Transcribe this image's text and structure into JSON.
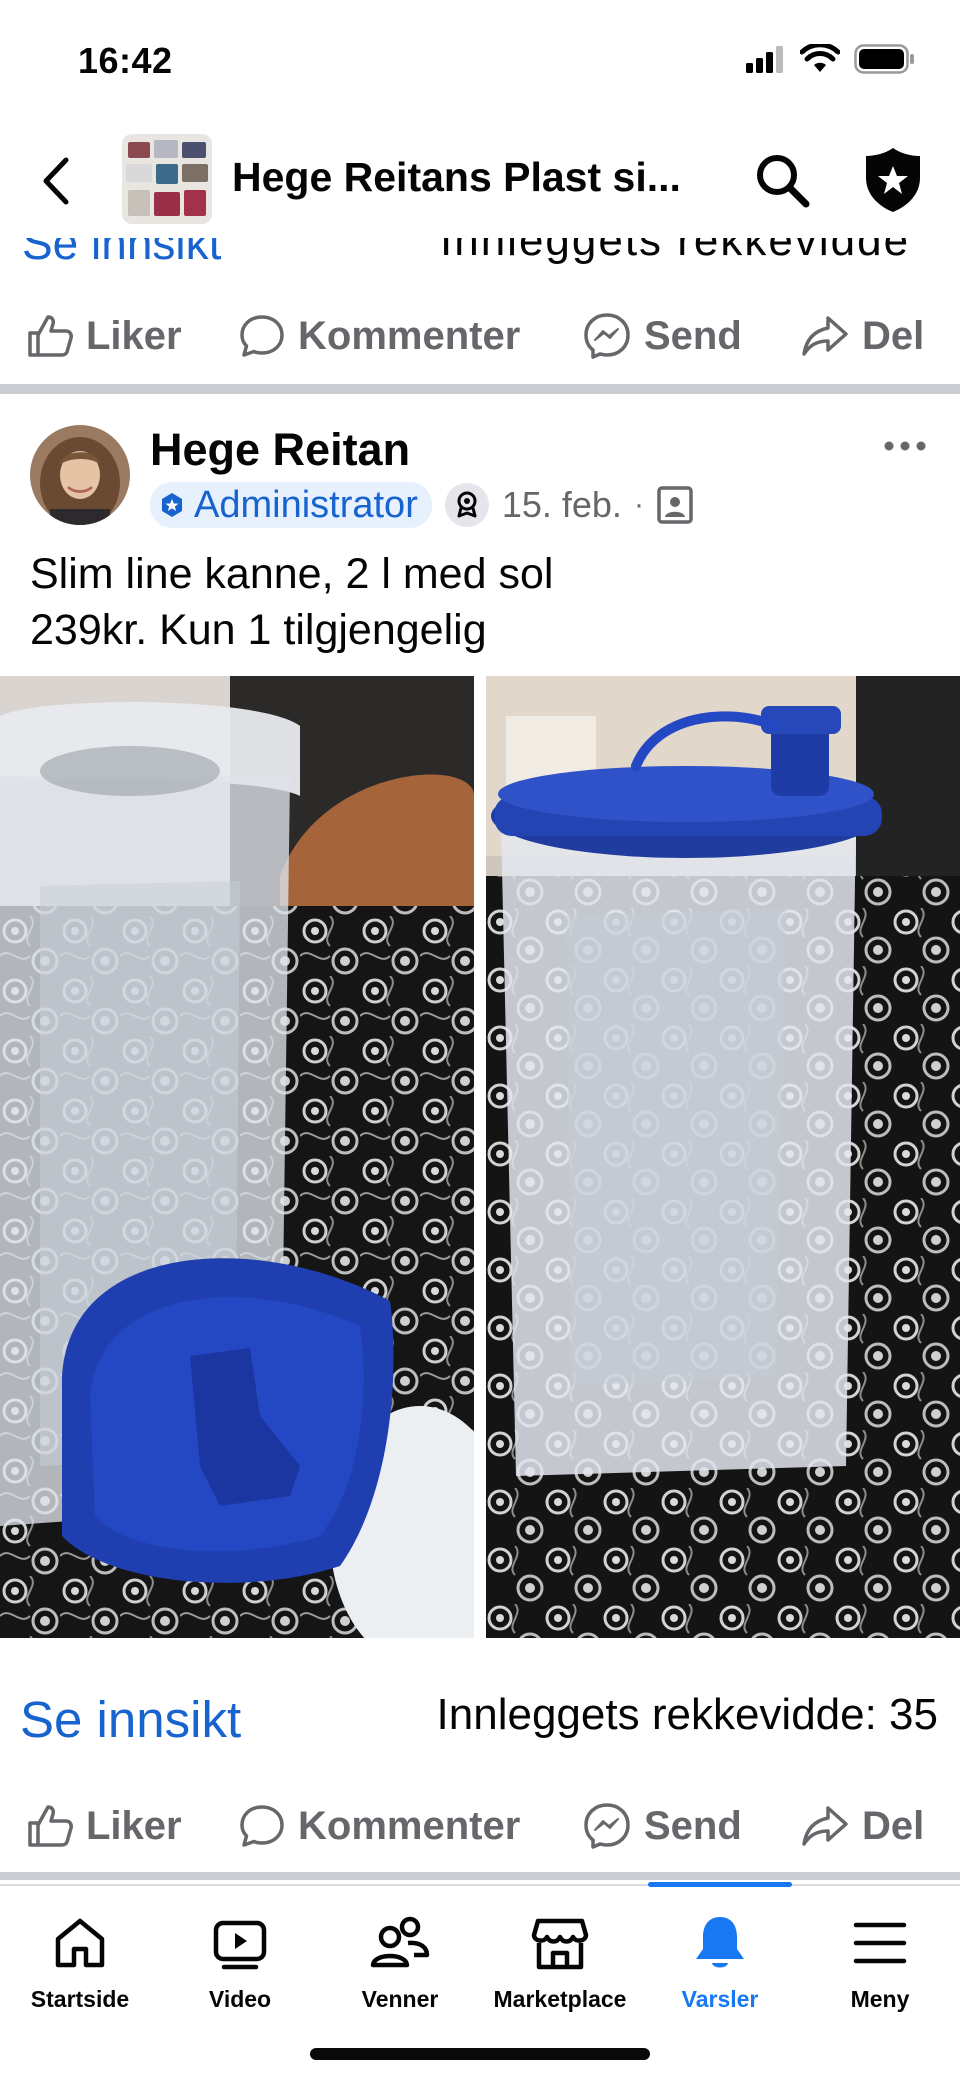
{
  "status_bar": {
    "time": "16:42"
  },
  "header": {
    "group_name": "Hege Reitans Plast si..."
  },
  "previous_post": {
    "cut_link": "Se innsikt",
    "cut_text": "Innleggets rekkevidde",
    "actions": {
      "like": "Liker",
      "comment": "Kommenter",
      "send": "Send",
      "share": "Del"
    }
  },
  "post": {
    "author": "Hege Reitan",
    "role": "Administrator",
    "date": "15. feb.",
    "separator": "·",
    "text_line1": "Slim line kanne, 2 l med sol",
    "text_line2": "239kr. Kun 1 tilgjengelig",
    "insight_link": "Se innsikt",
    "reach": "Innleggets rekkevidde: 35",
    "actions": {
      "like": "Liker",
      "comment": "Kommenter",
      "send": "Send",
      "share": "Del"
    }
  },
  "tab_bar": {
    "items": [
      {
        "label": "Startside",
        "icon": "home-icon"
      },
      {
        "label": "Video",
        "icon": "video-icon"
      },
      {
        "label": "Venner",
        "icon": "friends-icon"
      },
      {
        "label": "Marketplace",
        "icon": "marketplace-icon"
      },
      {
        "label": "Varsler",
        "icon": "bell-icon",
        "active": true
      },
      {
        "label": "Meny",
        "icon": "menu-icon"
      }
    ],
    "active_color": "#1877f2"
  },
  "colors": {
    "link": "#1763cf",
    "muted": "#65676b",
    "accent": "#1877f2"
  }
}
